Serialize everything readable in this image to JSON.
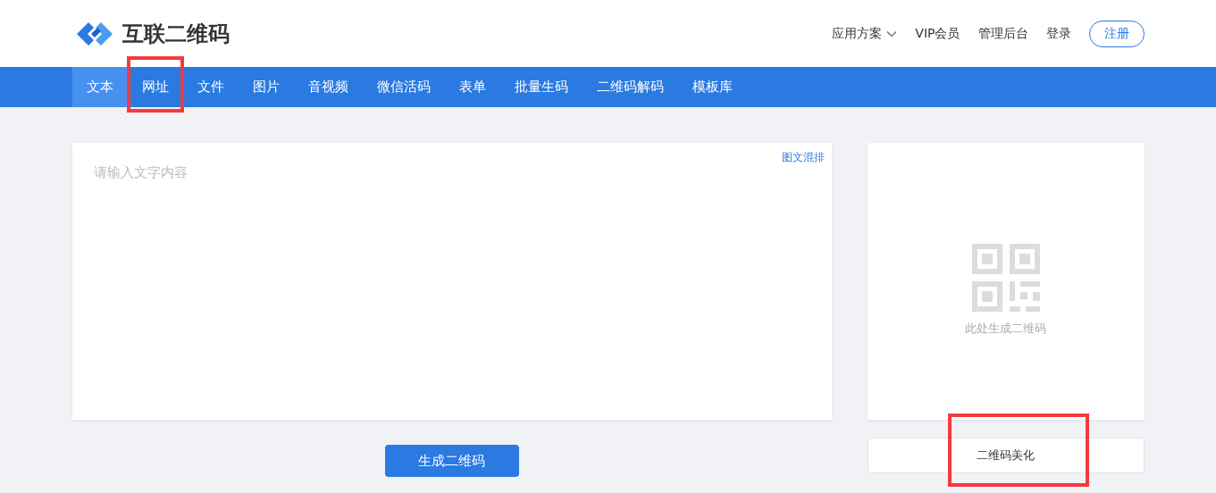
{
  "header": {
    "logo_text": "互联二维码",
    "links": [
      {
        "label": "应用方案",
        "kind": "dropdown"
      },
      {
        "label": "VIP会员",
        "kind": "link"
      },
      {
        "label": "管理后台",
        "kind": "link"
      },
      {
        "label": "登录",
        "kind": "link"
      },
      {
        "label": "注册",
        "kind": "outline"
      }
    ]
  },
  "tabs": [
    {
      "label": "文本",
      "selected": true,
      "highlighted": false
    },
    {
      "label": "网址",
      "selected": false,
      "highlighted": true
    },
    {
      "label": "文件",
      "selected": false,
      "highlighted": false
    },
    {
      "label": "图片",
      "selected": false,
      "highlighted": false
    },
    {
      "label": "音视频",
      "selected": false,
      "highlighted": false
    },
    {
      "label": "微信活码",
      "selected": false,
      "highlighted": false
    },
    {
      "label": "表单",
      "selected": false,
      "highlighted": false
    },
    {
      "label": "批量生码",
      "selected": false,
      "highlighted": false
    },
    {
      "label": "二维码解码",
      "selected": false,
      "highlighted": false
    },
    {
      "label": "模板库",
      "selected": false,
      "highlighted": false
    }
  ],
  "editor": {
    "placeholder": "请输入文字内容",
    "mixed_layout_link": "图文混排"
  },
  "generate_button": "生成二维码",
  "preview": {
    "hint": "此处生成二维码"
  },
  "beautify_button": {
    "label": "二维码美化",
    "highlighted": true
  }
}
